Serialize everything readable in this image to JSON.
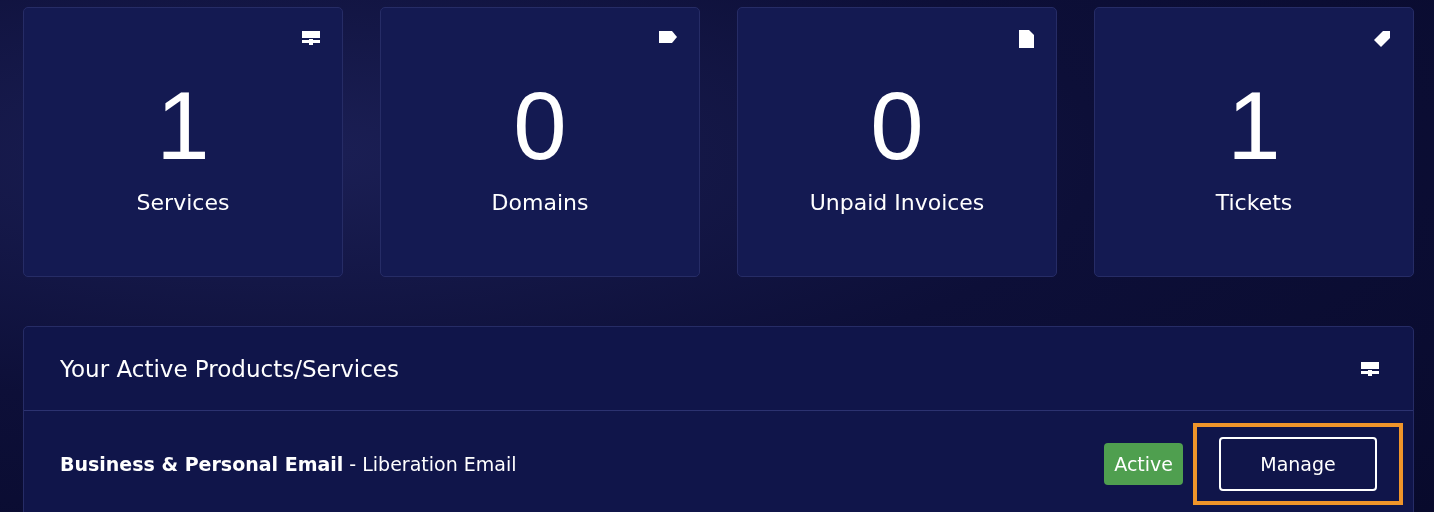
{
  "stats": [
    {
      "kind": "server",
      "count": "1",
      "label": "Services"
    },
    {
      "kind": "tag",
      "count": "0",
      "label": "Domains"
    },
    {
      "kind": "file",
      "count": "0",
      "label": "Unpaid Invoices"
    },
    {
      "kind": "ticket",
      "count": "1",
      "label": "Tickets"
    }
  ],
  "panel": {
    "title": "Your Active Products/Services",
    "kind": "server",
    "items": [
      {
        "product": "Business & Personal Email",
        "separator": " - ",
        "plan": "Liberation Email",
        "status": "Active",
        "action": "Manage",
        "highlighted": true
      }
    ]
  }
}
